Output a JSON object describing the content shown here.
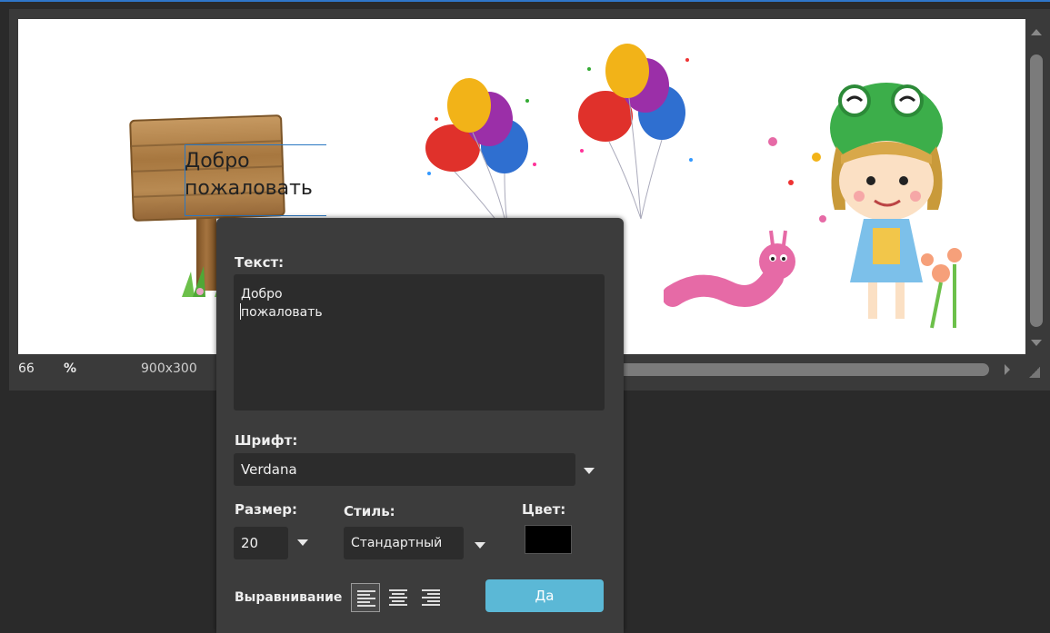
{
  "canvas": {
    "text_line1": "Добро",
    "text_line2": "пожаловать"
  },
  "statusbar": {
    "zoom_value": "66",
    "zoom_unit": "%",
    "dimensions": "900x300"
  },
  "dialog": {
    "text_label": "Текст:",
    "text_value": "Добро\nпожаловать",
    "font_label": "Шрифт:",
    "font_value": "Verdana",
    "size_label": "Размер:",
    "size_value": "20",
    "style_label": "Стиль:",
    "style_value": "Стандартный",
    "color_label": "Цвет:",
    "color_value": "#000000",
    "align_label": "Выравнивание",
    "ok_label": "Да"
  },
  "icons": [
    "align-left-icon",
    "align-center-icon",
    "align-right-icon",
    "chevron-down-icon"
  ]
}
